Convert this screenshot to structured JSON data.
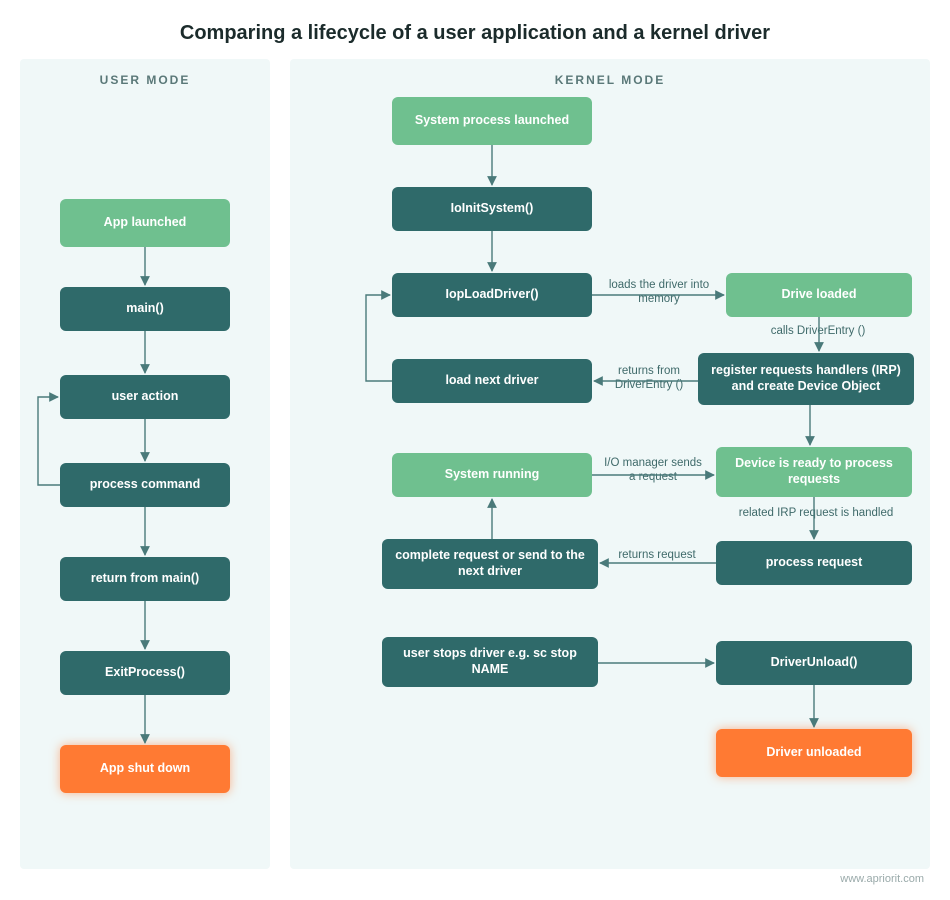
{
  "title": "Comparing a lifecycle of a user application and a kernel driver",
  "watermark": "www.apriorit.com",
  "panels": {
    "user": {
      "heading": "USER MODE"
    },
    "kernel": {
      "heading": "KERNEL MODE"
    }
  },
  "nodes": {
    "u_app_launched": "App launched",
    "u_main": "main()",
    "u_user_action": "user action",
    "u_process_cmd": "process command",
    "u_return_main": "return from main()",
    "u_exit_process": "ExitProcess()",
    "u_app_shutdown": "App shut down",
    "k_sys_launched": "System process launched",
    "k_ioinit": "IoInitSystem()",
    "k_iopload": "IopLoadDriver()",
    "k_drive_loaded": "Drive loaded",
    "k_load_next": "load next driver",
    "k_register": "register requests handlers (IRP) and create Device Object",
    "k_sys_running": "System running",
    "k_device_ready": "Device is ready to process requests",
    "k_complete_req": "complete request or send to the next driver",
    "k_process_req": "process request",
    "k_user_stops": "user stops driver e.g. sc stop NAME",
    "k_driver_unload": "DriverUnload()",
    "k_driver_unloaded": "Driver unloaded"
  },
  "edge_labels": {
    "loads_driver": "loads the driver into memory",
    "calls_de": "calls DriverEntry ()",
    "returns_de": "returns from DriverEntry ()",
    "io_mgr": "I/O manager sends a request",
    "irp_handled": "related IRP request is handled",
    "returns_req": "returns request"
  },
  "colors": {
    "teal": "#2f6a6a",
    "green": "#6fc08f",
    "orange": "#ff7a33",
    "arrow": "#4a7a7a",
    "panel_bg": "#f0f8f8"
  }
}
